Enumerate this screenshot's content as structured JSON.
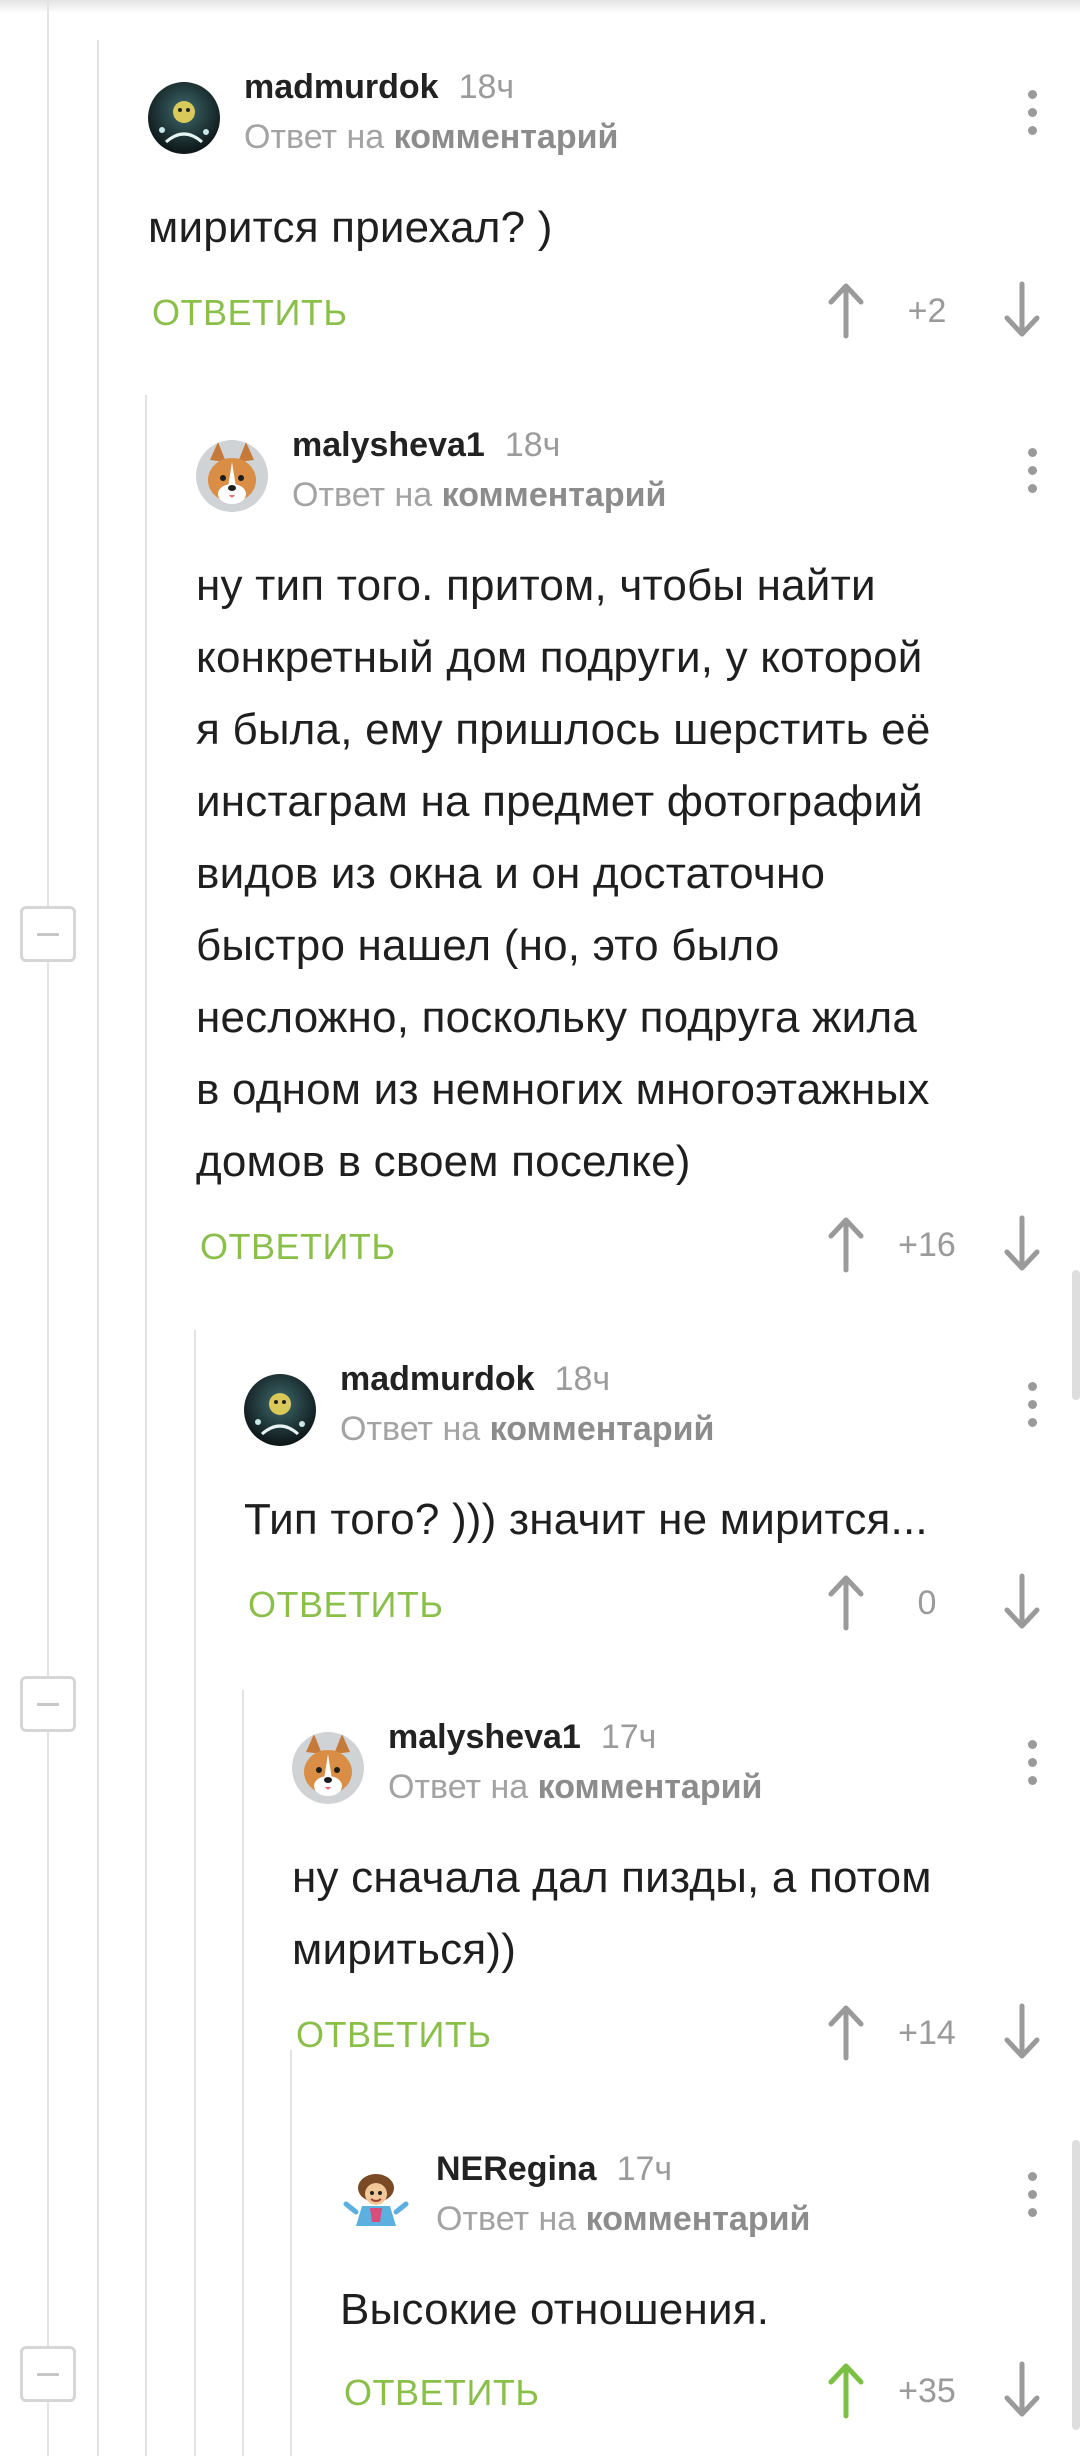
{
  "ui": {
    "reply_label": "ОТВЕТИТЬ",
    "reply_prefix": "Ответ на",
    "reply_target": "комментарий",
    "accent_green": "#8ac04a",
    "upvoted_green": "#7bc043",
    "arrow_gray": "#9a9a9a"
  },
  "comments": [
    {
      "author": "madmurdok",
      "time": "18ч",
      "avatar_icon": "dark-orb-avatar",
      "text": "мирится приехал? )",
      "votes": "+2",
      "upvoted": false
    },
    {
      "author": "malysheva1",
      "time": "18ч",
      "avatar_icon": "corgi-avatar",
      "text": "ну тип того. притом, чтобы найти\nконкретный дом подруги, у которой\nя была, ему пришлось шерстить её\nинстаграм на предмет фотографий\nвидов из окна и он достаточно\nбыстро нашел (но, это было\nнесложно, поскольку подруга жила\nв одном из немногих многоэтажных\nдомов в своем поселке)",
      "votes": "+16",
      "upvoted": false
    },
    {
      "author": "madmurdok",
      "time": "18ч",
      "avatar_icon": "dark-orb-avatar",
      "text": "Тип того? ))) значит не мирится...",
      "votes": "0",
      "upvoted": false
    },
    {
      "author": "malysheva1",
      "time": "17ч",
      "avatar_icon": "corgi-avatar",
      "text": "ну сначала дал пизды, а потом\nмириться))",
      "votes": "+14",
      "upvoted": false
    },
    {
      "author": "NERegina",
      "time": "17ч",
      "avatar_icon": "cartoon-character-avatar",
      "text": "Высокие отношения.",
      "votes": "+35",
      "upvoted": true
    }
  ]
}
